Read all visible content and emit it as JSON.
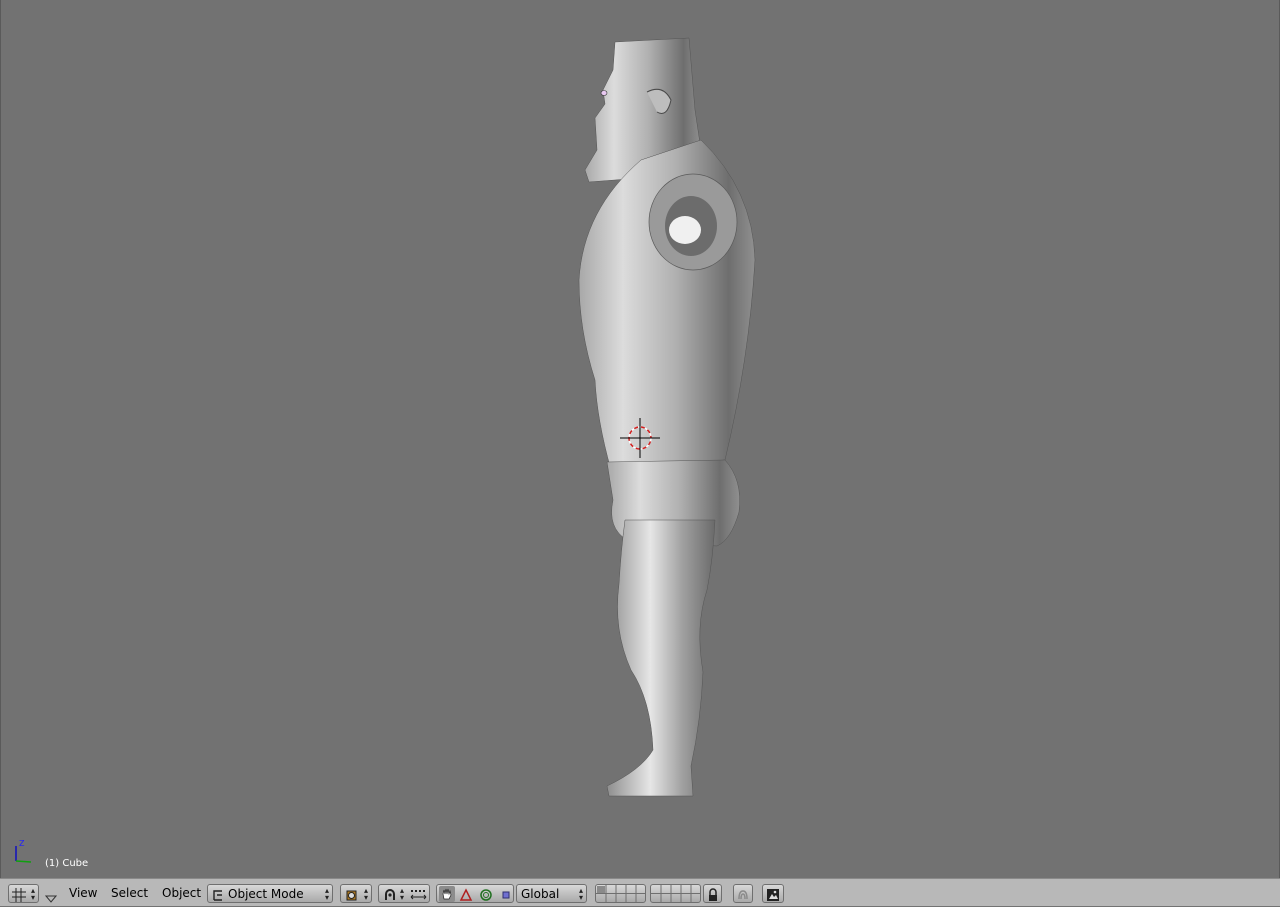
{
  "viewport": {
    "object_label": "(1) Cube",
    "axis_label": "Z"
  },
  "header": {
    "menus": [
      "View",
      "Select",
      "Object"
    ],
    "mode": "Object Mode",
    "orientation": "Global"
  },
  "icons": {
    "editor_type": "grid-icon",
    "collapse": "triangle-down-icon",
    "mode": "object-mode-icon",
    "draw_type": "draw-type-icon",
    "pivot": "pivot-icon",
    "snap": "snap-icon",
    "manipulator": "hand-icon",
    "translate": "translate-icon",
    "rotate": "rotate-icon",
    "scale": "scale-icon",
    "lock": "lock-icon",
    "ghost": "ghost-icon",
    "render": "render-icon"
  },
  "colors": {
    "viewport_bg": "#727272",
    "header_bg": "#b8b8b8"
  }
}
